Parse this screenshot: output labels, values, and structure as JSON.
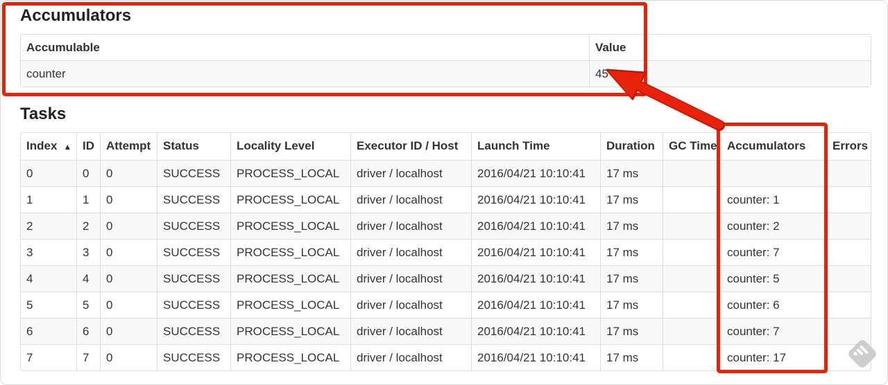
{
  "accumulators_section": {
    "title": "Accumulators",
    "table": {
      "columns": [
        {
          "label": "Accumulable"
        },
        {
          "label": "Value"
        }
      ],
      "rows": [
        [
          "counter",
          "45"
        ]
      ]
    }
  },
  "tasks_section": {
    "title": "Tasks",
    "table": {
      "columns": [
        {
          "label": "Index",
          "sort_icon": "▲"
        },
        {
          "label": "ID"
        },
        {
          "label": "Attempt"
        },
        {
          "label": "Status"
        },
        {
          "label": "Locality Level"
        },
        {
          "label": "Executor ID / Host"
        },
        {
          "label": "Launch Time"
        },
        {
          "label": "Duration"
        },
        {
          "label": "GC Time"
        },
        {
          "label": "Accumulators"
        },
        {
          "label": "Errors"
        }
      ],
      "rows": [
        [
          "0",
          "0",
          "0",
          "SUCCESS",
          "PROCESS_LOCAL",
          "driver / localhost",
          "2016/04/21 10:10:41",
          "17 ms",
          "",
          "",
          ""
        ],
        [
          "1",
          "1",
          "0",
          "SUCCESS",
          "PROCESS_LOCAL",
          "driver / localhost",
          "2016/04/21 10:10:41",
          "17 ms",
          "",
          "counter: 1",
          ""
        ],
        [
          "2",
          "2",
          "0",
          "SUCCESS",
          "PROCESS_LOCAL",
          "driver / localhost",
          "2016/04/21 10:10:41",
          "17 ms",
          "",
          "counter: 2",
          ""
        ],
        [
          "3",
          "3",
          "0",
          "SUCCESS",
          "PROCESS_LOCAL",
          "driver / localhost",
          "2016/04/21 10:10:41",
          "17 ms",
          "",
          "counter: 7",
          ""
        ],
        [
          "4",
          "4",
          "0",
          "SUCCESS",
          "PROCESS_LOCAL",
          "driver / localhost",
          "2016/04/21 10:10:41",
          "17 ms",
          "",
          "counter: 5",
          ""
        ],
        [
          "5",
          "5",
          "0",
          "SUCCESS",
          "PROCESS_LOCAL",
          "driver / localhost",
          "2016/04/21 10:10:41",
          "17 ms",
          "",
          "counter: 6",
          ""
        ],
        [
          "6",
          "6",
          "0",
          "SUCCESS",
          "PROCESS_LOCAL",
          "driver / localhost",
          "2016/04/21 10:10:41",
          "17 ms",
          "",
          "counter: 7",
          ""
        ],
        [
          "7",
          "7",
          "0",
          "SUCCESS",
          "PROCESS_LOCAL",
          "driver / localhost",
          "2016/04/21 10:10:41",
          "17 ms",
          "",
          "counter: 17",
          ""
        ]
      ]
    }
  },
  "annotations": {
    "color": "#e8220a",
    "outline_color": "#bb1a00"
  },
  "watermark": {
    "color": "#c9c9c9",
    "stripe_color": "#ffffff"
  },
  "table_style": {
    "border_color": "#dddddd",
    "stripe_bg": "#f9f9f9",
    "text_color": "#333333"
  }
}
